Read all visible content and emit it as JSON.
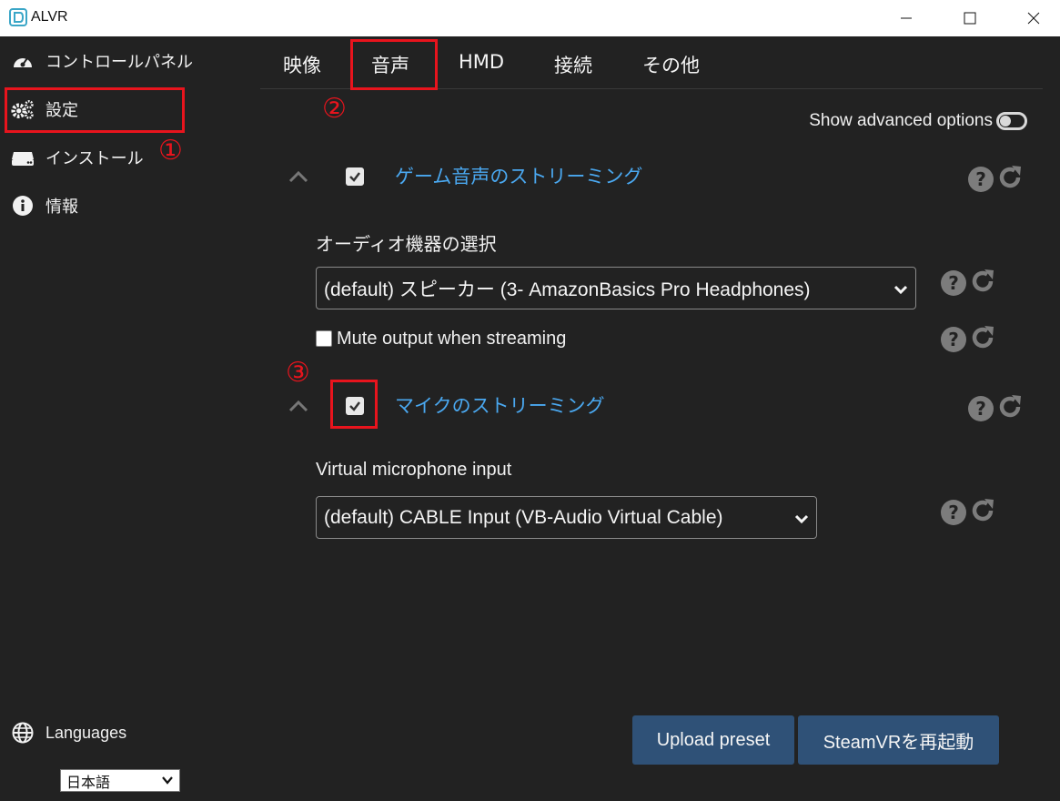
{
  "window": {
    "title": "ALVR"
  },
  "sidebar": {
    "items": [
      {
        "label": "コントロールパネル",
        "icon": "dashboard-icon"
      },
      {
        "label": "設定",
        "icon": "gears-icon"
      },
      {
        "label": "インストール",
        "icon": "drive-icon"
      },
      {
        "label": "情報",
        "icon": "info-icon"
      }
    ],
    "languages_label": "Languages",
    "language_value": "日本語"
  },
  "tabs": [
    {
      "label": "映像"
    },
    {
      "label": "音声"
    },
    {
      "label": "HMD"
    },
    {
      "label": "接続"
    },
    {
      "label": "その他"
    }
  ],
  "annotations": [
    "①",
    "②",
    "③"
  ],
  "main": {
    "advanced_label": "Show advanced options",
    "game_audio": {
      "title": "ゲーム音声のストリーミング",
      "device_label": "オーディオ機器の選択",
      "device_value": "(default) スピーカー (3- AmazonBasics Pro Headphones)",
      "mute_label": "Mute output when streaming"
    },
    "microphone": {
      "title": "マイクのストリーミング",
      "input_label": "Virtual microphone input",
      "input_value": "(default) CABLE Input (VB-Audio Virtual Cable)"
    }
  },
  "buttons": {
    "upload": "Upload preset",
    "restart": "SteamVRを再起動"
  },
  "colors": {
    "background": "#222222",
    "accent_title": "#4aa8f0",
    "button": "#2f5177",
    "annotation_red": "#e8141d"
  }
}
